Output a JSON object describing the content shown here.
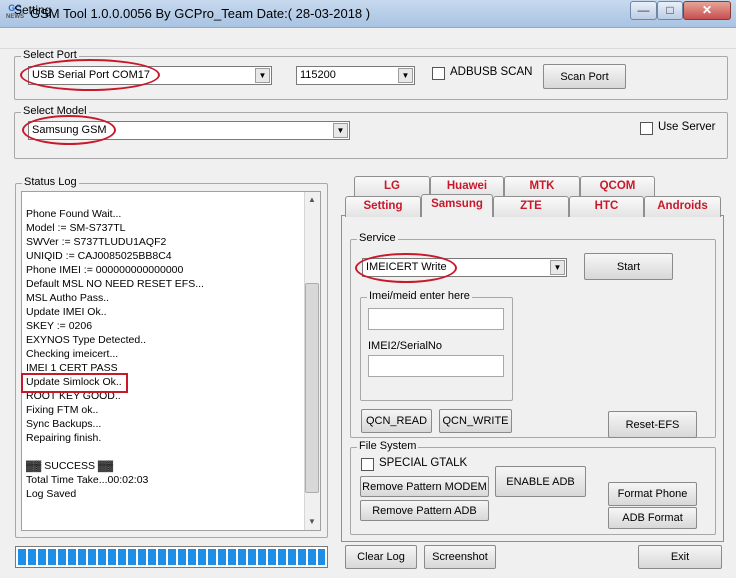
{
  "window": {
    "title": "GSM Tool 1.0.0.0056 By GCPro_Team  Date:( 28-03-2018 )",
    "icon_text": "GC",
    "icon_sub": "NEWS",
    "controls": {
      "minimize": "—",
      "maximize": "□",
      "close": "✕"
    }
  },
  "menu": {
    "setting": "Setting"
  },
  "select_port": {
    "label": "Select Port",
    "port_value": "USB Serial Port COM17",
    "baud_value": "115200",
    "adbusb_label": "ADBUSB SCAN",
    "scan_button": "Scan Port"
  },
  "select_model": {
    "label": "Select Model",
    "model_value": "Samsung GSM",
    "use_server_label": "Use Server"
  },
  "status_log": {
    "label": "Status Log",
    "lines": [
      "Phone Found Wait...",
      "Model := SM-S737TL",
      "SWVer := S737TLUDU1AQF2",
      "UNIQID := CAJ0085025BB8C4",
      "Phone IMEI := 000000000000000",
      "Default MSL NO NEED RESET EFS...",
      "MSL Autho Pass..",
      "Update IMEI Ok..",
      "SKEY := 0206",
      "EXYNOS Type Detected..",
      "Checking imeicert...",
      "IMEI 1 CERT PASS",
      "Update Simlock Ok..",
      "ROOT KEY GOOD..",
      "Fixing FTM ok..",
      "Sync Backups...",
      "Repairing finish.",
      "",
      "▓▓ SUCCESS ▓▓",
      "Total Time Take...00:02:03",
      "Log Saved"
    ]
  },
  "progress": {
    "value_percent": 100
  },
  "tabs": {
    "row1": [
      "LG",
      "Huawei",
      "MTK",
      "QCOM"
    ],
    "row2": [
      "Setting",
      "Samsung",
      "ZTE",
      "HTC",
      "Androids"
    ],
    "active": "Samsung"
  },
  "service": {
    "label": "Service",
    "value": "IMEICERT Write",
    "start_button": "Start",
    "imei_group_label": "Imei/meid enter here",
    "imei2_label": "IMEI2/SerialNo",
    "qcn_read": "QCN_READ",
    "qcn_write": "QCN_WRITE",
    "reset_efs": "Reset-EFS"
  },
  "file_system": {
    "label": "File System",
    "special_gtalk": "SPECIAL GTALK",
    "remove_pattern_modem": "Remove Pattern MODEM",
    "remove_pattern_adb": "Remove Pattern ADB",
    "enable_adb": "ENABLE ADB",
    "format_phone": "Format Phone",
    "adb_format": "ADB Format"
  },
  "bottom": {
    "clear_log": "Clear Log",
    "screenshot": "Screenshot",
    "exit": "Exit"
  },
  "colors": {
    "tab_text": "#c8192b",
    "highlight": "#c8192b",
    "progress": "#1f8ee6"
  }
}
